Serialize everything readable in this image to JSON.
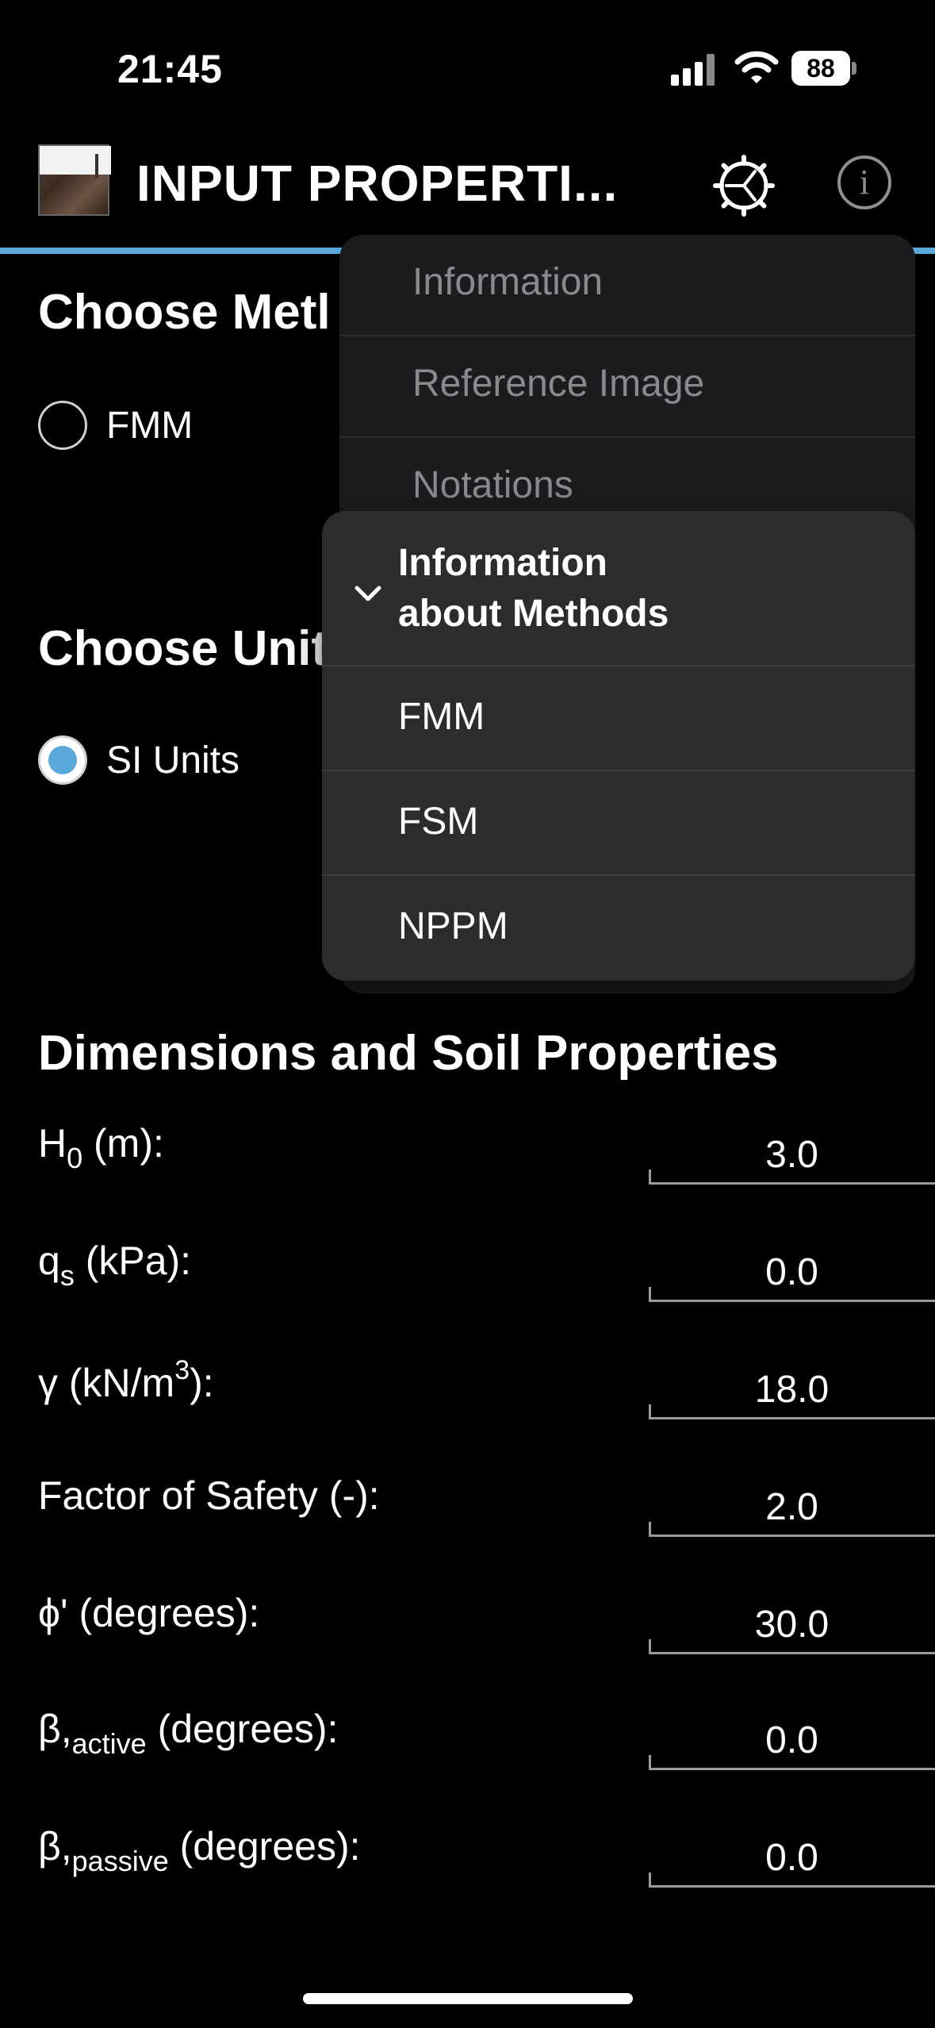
{
  "status": {
    "time": "21:45",
    "battery": "88"
  },
  "header": {
    "title": "INPUT PROPERTI..."
  },
  "method_section": {
    "title": "Choose Metl",
    "option_fmm": "FMM"
  },
  "units_section": {
    "title": "Choose Unit",
    "option_si": "SI Units"
  },
  "dimensions": {
    "title": "Dimensions and Soil Properties",
    "rows": [
      {
        "label": "H",
        "sub": "0",
        "suffix": " (m):",
        "value": "3.0"
      },
      {
        "label": "q",
        "sub": "s",
        "suffix": " (kPa):",
        "value": "0.0"
      },
      {
        "label": "γ (kN/m",
        "sup": "3",
        "suffix": "):",
        "value": "18.0"
      },
      {
        "label": "Factor of Safety (-):",
        "value": "2.0"
      },
      {
        "label": "ϕ' (degrees):",
        "value": "30.0"
      },
      {
        "label": "β,",
        "sub": "active",
        "suffix": " (degrees):",
        "value": "0.0"
      },
      {
        "label": "β,",
        "sub": "passive",
        "suffix": " (degrees):",
        "value": "0.0"
      }
    ]
  },
  "info_menu": {
    "items": [
      "Information",
      "Reference Image",
      "Notations"
    ]
  },
  "submenu": {
    "header_line1": "Information",
    "header_line2": "about Methods",
    "items": [
      "FMM",
      "FSM",
      "NPPM"
    ]
  },
  "colors": {
    "accent": "#5aa7dc",
    "background": "#000000",
    "menu": "#2c2c2e"
  }
}
